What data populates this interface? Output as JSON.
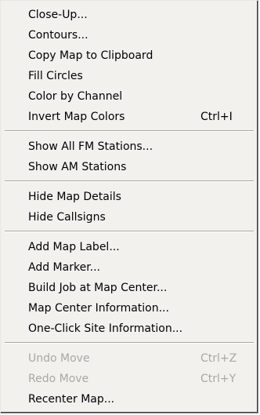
{
  "menu": {
    "groups": [
      {
        "items": [
          {
            "label": "Close-Up...",
            "shortcut": "",
            "enabled": true
          },
          {
            "label": "Contours...",
            "shortcut": "",
            "enabled": true
          },
          {
            "label": "Copy Map to Clipboard",
            "shortcut": "",
            "enabled": true
          },
          {
            "label": "Fill Circles",
            "shortcut": "",
            "enabled": true
          },
          {
            "label": "Color by Channel",
            "shortcut": "",
            "enabled": true
          },
          {
            "label": "Invert Map Colors",
            "shortcut": "Ctrl+I",
            "enabled": true
          }
        ]
      },
      {
        "items": [
          {
            "label": "Show All FM Stations...",
            "shortcut": "",
            "enabled": true
          },
          {
            "label": "Show AM Stations",
            "shortcut": "",
            "enabled": true
          }
        ]
      },
      {
        "items": [
          {
            "label": "Hide Map Details",
            "shortcut": "",
            "enabled": true
          },
          {
            "label": "Hide Callsigns",
            "shortcut": "",
            "enabled": true
          }
        ]
      },
      {
        "items": [
          {
            "label": "Add Map Label...",
            "shortcut": "",
            "enabled": true
          },
          {
            "label": "Add Marker...",
            "shortcut": "",
            "enabled": true
          },
          {
            "label": "Build Job at Map Center...",
            "shortcut": "",
            "enabled": true
          },
          {
            "label": "Map Center Information...",
            "shortcut": "",
            "enabled": true
          },
          {
            "label": "One-Click Site Information...",
            "shortcut": "",
            "enabled": true
          }
        ]
      },
      {
        "items": [
          {
            "label": "Undo Move",
            "shortcut": "Ctrl+Z",
            "enabled": false
          },
          {
            "label": "Redo Move",
            "shortcut": "Ctrl+Y",
            "enabled": false
          },
          {
            "label": "Recenter Map...",
            "shortcut": "",
            "enabled": true
          }
        ]
      }
    ]
  },
  "colors": {
    "menu_bg": "#f2f1ee",
    "text": "#000000",
    "disabled_text": "#a9a8a5"
  }
}
